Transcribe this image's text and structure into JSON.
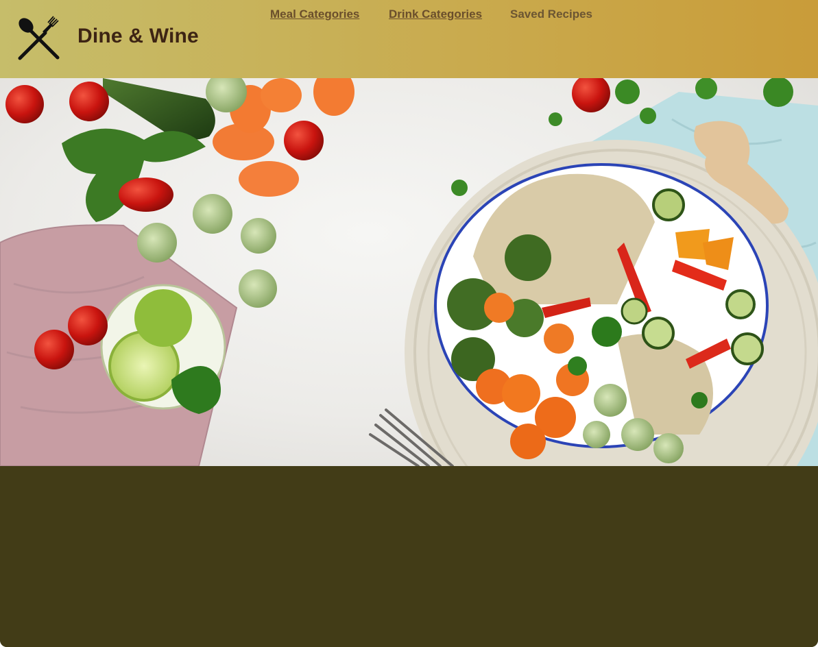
{
  "brand": {
    "name": "Dine & Wine",
    "logo_icon": "fork-and-spoon-icon"
  },
  "nav": {
    "items": [
      {
        "label": "Meal Categories"
      },
      {
        "label": "Drink Categories"
      },
      {
        "label": "Saved Recipes"
      }
    ]
  },
  "hero": {
    "image": "healthy-bowl-vegetables-photo"
  },
  "colors": {
    "header_gradient_start": "#c6bd6a",
    "header_gradient_end": "#c99c39",
    "brand_text": "#3d2414",
    "nav_text": "#6a4e2b",
    "page_background": "#423c17"
  }
}
